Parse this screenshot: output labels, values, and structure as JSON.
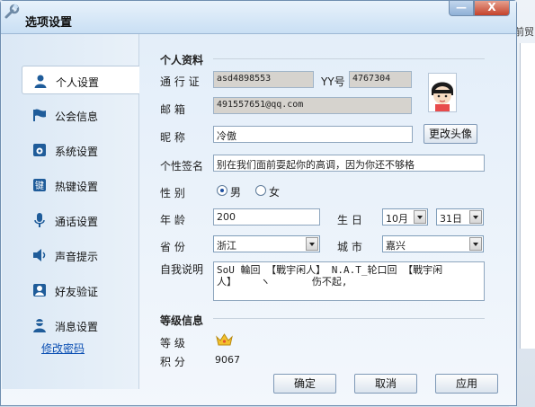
{
  "background_window": {
    "fragment_text": "前贸"
  },
  "window": {
    "title": "选项设置",
    "min_label": "—",
    "close_label": "X"
  },
  "sidebar": {
    "items": [
      {
        "label": "个人设置",
        "icon": "person-icon",
        "active": true
      },
      {
        "label": "公会信息",
        "icon": "flag-icon",
        "active": false
      },
      {
        "label": "系统设置",
        "icon": "settings-icon",
        "active": false
      },
      {
        "label": "热键设置",
        "icon": "hotkey-icon",
        "active": false
      },
      {
        "label": "通话设置",
        "icon": "microphone-icon",
        "active": false
      },
      {
        "label": "声音提示",
        "icon": "speaker-icon",
        "active": false
      },
      {
        "label": "好友验证",
        "icon": "friend-verify-icon",
        "active": false
      },
      {
        "label": "消息设置",
        "icon": "message-settings-icon",
        "active": false
      }
    ],
    "change_password": "修改密码"
  },
  "personal": {
    "section_title": "个人资料",
    "pass_label": "通 行 证",
    "pass_value": "asd4898553",
    "yy_label": "YY号",
    "yy_value": "4767304",
    "email_label": "邮    箱",
    "email_value": "491557651@qq.com",
    "nick_label": "昵    称",
    "nick_value": "冷傲",
    "change_avatar": "更改头像",
    "sign_label": "个性签名",
    "sign_value": "别在我们面前耍起你的高调，因为你还不够格",
    "gender_label": "性    别",
    "gender_male": "男",
    "gender_female": "女",
    "gender_selected": "male",
    "age_label": "年    龄",
    "age_value": "200",
    "birthday_label": "生  日",
    "birth_month": "10月",
    "birth_day": "31日",
    "province_label": "省    份",
    "province_value": "浙江",
    "city_label": "城  市",
    "city_value": "嘉兴",
    "intro_label": "自我说明",
    "intro_line1": "SoU 輪回    【戰宇闲人】  N.A.T_轮口回  【戰宇闲",
    "intro_line2": "人】    ヽ       伤不起,"
  },
  "level": {
    "section_title": "等级信息",
    "level_label": "等    级",
    "level_icon": "crown-icon",
    "points_label": "积    分",
    "points_value": "9067"
  },
  "buttons": {
    "ok": "确定",
    "cancel": "取消",
    "apply": "应用"
  },
  "colors": {
    "title_bar": "#c9dff4",
    "close_button": "#c4422b",
    "link": "#0b4fb3",
    "readonly_field": "#d6d3ce"
  }
}
